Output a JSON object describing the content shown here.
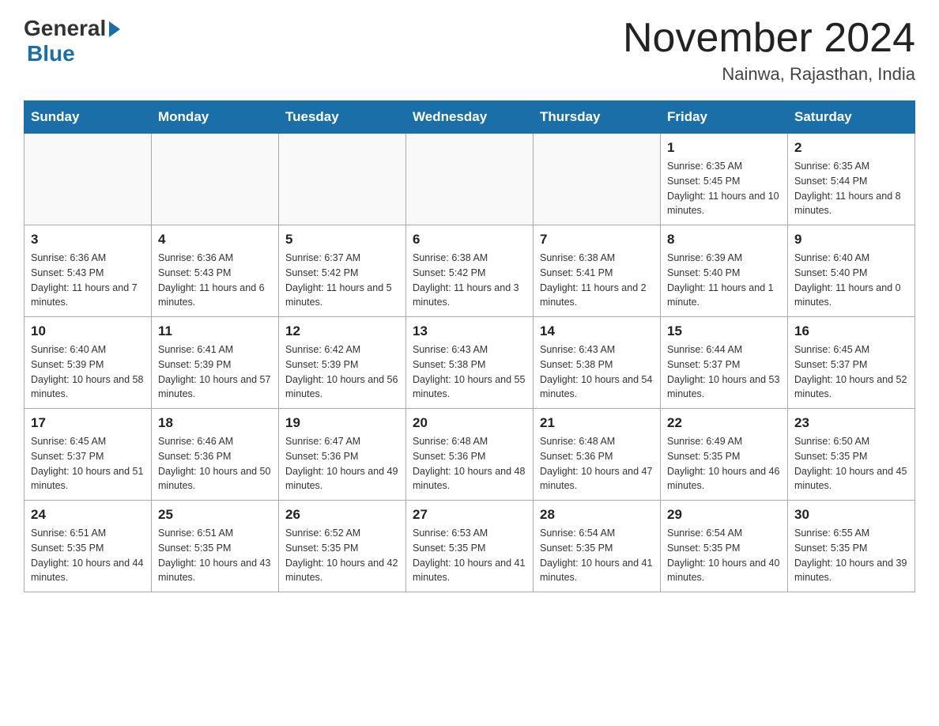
{
  "header": {
    "logo_text": "General",
    "logo_blue": "Blue",
    "title": "November 2024",
    "subtitle": "Nainwa, Rajasthan, India"
  },
  "days_of_week": [
    "Sunday",
    "Monday",
    "Tuesday",
    "Wednesday",
    "Thursday",
    "Friday",
    "Saturday"
  ],
  "weeks": [
    [
      {
        "day": "",
        "sunrise": "",
        "sunset": "",
        "daylight": ""
      },
      {
        "day": "",
        "sunrise": "",
        "sunset": "",
        "daylight": ""
      },
      {
        "day": "",
        "sunrise": "",
        "sunset": "",
        "daylight": ""
      },
      {
        "day": "",
        "sunrise": "",
        "sunset": "",
        "daylight": ""
      },
      {
        "day": "",
        "sunrise": "",
        "sunset": "",
        "daylight": ""
      },
      {
        "day": "1",
        "sunrise": "Sunrise: 6:35 AM",
        "sunset": "Sunset: 5:45 PM",
        "daylight": "Daylight: 11 hours and 10 minutes."
      },
      {
        "day": "2",
        "sunrise": "Sunrise: 6:35 AM",
        "sunset": "Sunset: 5:44 PM",
        "daylight": "Daylight: 11 hours and 8 minutes."
      }
    ],
    [
      {
        "day": "3",
        "sunrise": "Sunrise: 6:36 AM",
        "sunset": "Sunset: 5:43 PM",
        "daylight": "Daylight: 11 hours and 7 minutes."
      },
      {
        "day": "4",
        "sunrise": "Sunrise: 6:36 AM",
        "sunset": "Sunset: 5:43 PM",
        "daylight": "Daylight: 11 hours and 6 minutes."
      },
      {
        "day": "5",
        "sunrise": "Sunrise: 6:37 AM",
        "sunset": "Sunset: 5:42 PM",
        "daylight": "Daylight: 11 hours and 5 minutes."
      },
      {
        "day": "6",
        "sunrise": "Sunrise: 6:38 AM",
        "sunset": "Sunset: 5:42 PM",
        "daylight": "Daylight: 11 hours and 3 minutes."
      },
      {
        "day": "7",
        "sunrise": "Sunrise: 6:38 AM",
        "sunset": "Sunset: 5:41 PM",
        "daylight": "Daylight: 11 hours and 2 minutes."
      },
      {
        "day": "8",
        "sunrise": "Sunrise: 6:39 AM",
        "sunset": "Sunset: 5:40 PM",
        "daylight": "Daylight: 11 hours and 1 minute."
      },
      {
        "day": "9",
        "sunrise": "Sunrise: 6:40 AM",
        "sunset": "Sunset: 5:40 PM",
        "daylight": "Daylight: 11 hours and 0 minutes."
      }
    ],
    [
      {
        "day": "10",
        "sunrise": "Sunrise: 6:40 AM",
        "sunset": "Sunset: 5:39 PM",
        "daylight": "Daylight: 10 hours and 58 minutes."
      },
      {
        "day": "11",
        "sunrise": "Sunrise: 6:41 AM",
        "sunset": "Sunset: 5:39 PM",
        "daylight": "Daylight: 10 hours and 57 minutes."
      },
      {
        "day": "12",
        "sunrise": "Sunrise: 6:42 AM",
        "sunset": "Sunset: 5:39 PM",
        "daylight": "Daylight: 10 hours and 56 minutes."
      },
      {
        "day": "13",
        "sunrise": "Sunrise: 6:43 AM",
        "sunset": "Sunset: 5:38 PM",
        "daylight": "Daylight: 10 hours and 55 minutes."
      },
      {
        "day": "14",
        "sunrise": "Sunrise: 6:43 AM",
        "sunset": "Sunset: 5:38 PM",
        "daylight": "Daylight: 10 hours and 54 minutes."
      },
      {
        "day": "15",
        "sunrise": "Sunrise: 6:44 AM",
        "sunset": "Sunset: 5:37 PM",
        "daylight": "Daylight: 10 hours and 53 minutes."
      },
      {
        "day": "16",
        "sunrise": "Sunrise: 6:45 AM",
        "sunset": "Sunset: 5:37 PM",
        "daylight": "Daylight: 10 hours and 52 minutes."
      }
    ],
    [
      {
        "day": "17",
        "sunrise": "Sunrise: 6:45 AM",
        "sunset": "Sunset: 5:37 PM",
        "daylight": "Daylight: 10 hours and 51 minutes."
      },
      {
        "day": "18",
        "sunrise": "Sunrise: 6:46 AM",
        "sunset": "Sunset: 5:36 PM",
        "daylight": "Daylight: 10 hours and 50 minutes."
      },
      {
        "day": "19",
        "sunrise": "Sunrise: 6:47 AM",
        "sunset": "Sunset: 5:36 PM",
        "daylight": "Daylight: 10 hours and 49 minutes."
      },
      {
        "day": "20",
        "sunrise": "Sunrise: 6:48 AM",
        "sunset": "Sunset: 5:36 PM",
        "daylight": "Daylight: 10 hours and 48 minutes."
      },
      {
        "day": "21",
        "sunrise": "Sunrise: 6:48 AM",
        "sunset": "Sunset: 5:36 PM",
        "daylight": "Daylight: 10 hours and 47 minutes."
      },
      {
        "day": "22",
        "sunrise": "Sunrise: 6:49 AM",
        "sunset": "Sunset: 5:35 PM",
        "daylight": "Daylight: 10 hours and 46 minutes."
      },
      {
        "day": "23",
        "sunrise": "Sunrise: 6:50 AM",
        "sunset": "Sunset: 5:35 PM",
        "daylight": "Daylight: 10 hours and 45 minutes."
      }
    ],
    [
      {
        "day": "24",
        "sunrise": "Sunrise: 6:51 AM",
        "sunset": "Sunset: 5:35 PM",
        "daylight": "Daylight: 10 hours and 44 minutes."
      },
      {
        "day": "25",
        "sunrise": "Sunrise: 6:51 AM",
        "sunset": "Sunset: 5:35 PM",
        "daylight": "Daylight: 10 hours and 43 minutes."
      },
      {
        "day": "26",
        "sunrise": "Sunrise: 6:52 AM",
        "sunset": "Sunset: 5:35 PM",
        "daylight": "Daylight: 10 hours and 42 minutes."
      },
      {
        "day": "27",
        "sunrise": "Sunrise: 6:53 AM",
        "sunset": "Sunset: 5:35 PM",
        "daylight": "Daylight: 10 hours and 41 minutes."
      },
      {
        "day": "28",
        "sunrise": "Sunrise: 6:54 AM",
        "sunset": "Sunset: 5:35 PM",
        "daylight": "Daylight: 10 hours and 41 minutes."
      },
      {
        "day": "29",
        "sunrise": "Sunrise: 6:54 AM",
        "sunset": "Sunset: 5:35 PM",
        "daylight": "Daylight: 10 hours and 40 minutes."
      },
      {
        "day": "30",
        "sunrise": "Sunrise: 6:55 AM",
        "sunset": "Sunset: 5:35 PM",
        "daylight": "Daylight: 10 hours and 39 minutes."
      }
    ]
  ]
}
